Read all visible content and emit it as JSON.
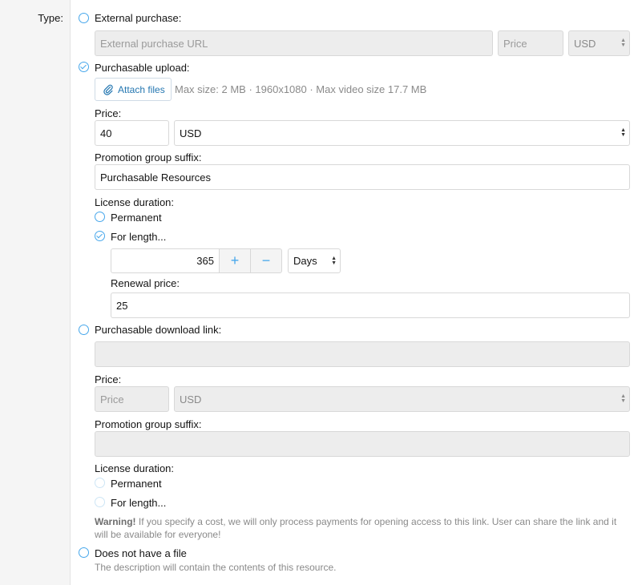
{
  "type_label": "Type:",
  "external": {
    "label": "External purchase:",
    "url_placeholder": "External purchase URL",
    "price_placeholder": "Price",
    "currency": "USD"
  },
  "upload": {
    "label": "Purchasable upload:",
    "attach_label": "Attach files",
    "attach_hint": "Max size: 2 MB · 1960x1080 · Max video size 17.7 MB",
    "price_label": "Price:",
    "price_value": "40",
    "currency": "USD",
    "promo_label": "Promotion group suffix:",
    "promo_value": "Purchasable Resources",
    "license_label": "License duration:",
    "permanent_label": "Permanent",
    "for_length_label": "For length...",
    "length_value": "365",
    "plus": "+",
    "minus": "−",
    "unit": "Days",
    "renewal_label": "Renewal price:",
    "renewal_value": "25"
  },
  "download": {
    "label": "Purchasable download link:",
    "price_label": "Price:",
    "price_placeholder": "Price",
    "currency": "USD",
    "promo_label": "Promotion group suffix:",
    "license_label": "License duration:",
    "permanent_label": "Permanent",
    "for_length_label": "For length...",
    "warning_strong": "Warning!",
    "warning_text": " If you specify a cost, we will only process payments for opening access to this link. User can share the link and it will be available for everyone!"
  },
  "nofile": {
    "label": "Does not have a file",
    "explain": "The description will contain the contents of this resource."
  },
  "colors": {
    "accent": "#47a7eb",
    "link": "#2577b1",
    "muted": "#8a8a8a"
  }
}
